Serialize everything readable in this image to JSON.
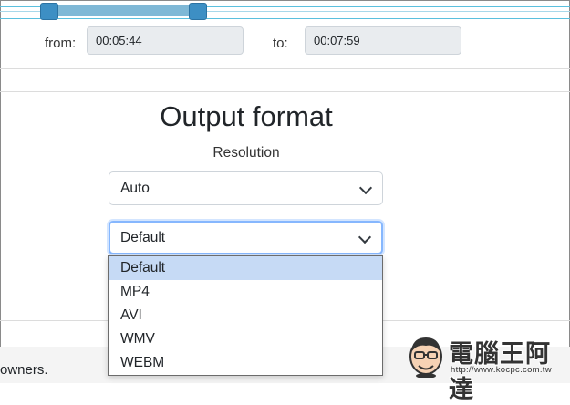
{
  "range": {
    "from_label": "from:",
    "from_value": "00:05:44",
    "to_label": "to:",
    "to_value": "00:07:59"
  },
  "output": {
    "title": "Output format",
    "resolution_label": "Resolution",
    "resolution_value": "Auto",
    "format_value": "Default",
    "format_options": [
      "Default",
      "MP4",
      "AVI",
      "WMV",
      "WEBM"
    ]
  },
  "footer": {
    "text": "owners."
  },
  "watermark": {
    "title": "電腦王阿達",
    "url": "http://www.kocpc.com.tw"
  },
  "colors": {
    "accent": "#3d8fc4",
    "focus_ring": "#86b7fe",
    "selected_option": "#c6daf5"
  }
}
